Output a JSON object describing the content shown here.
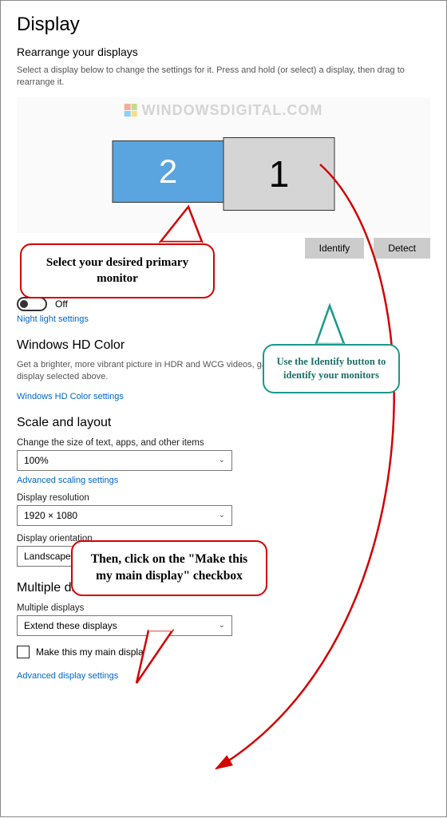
{
  "header": {
    "title": "Display"
  },
  "rearrange": {
    "title": "Rearrange your displays",
    "help": "Select a display below to change the settings for it. Press and hold (or select) a display, then drag to rearrange it.",
    "watermark": "WINDOWSDIGITAL.COM",
    "monitor1_label": "1",
    "monitor2_label": "2",
    "identify_btn": "Identify",
    "detect_btn": "Detect"
  },
  "night_light": {
    "state": "Off",
    "settings_link": "Night light settings"
  },
  "hd_color": {
    "title": "Windows HD Color",
    "help": "Get a brighter, more vibrant picture in HDR and WCG videos, games, and apps on the display selected above.",
    "link": "Windows HD Color settings"
  },
  "scale_layout": {
    "title": "Scale and layout",
    "scale_label": "Change the size of text, apps, and other items",
    "scale_value": "100%",
    "advanced_scaling_link": "Advanced scaling settings",
    "resolution_label": "Display resolution",
    "resolution_value": "1920 × 1080",
    "orientation_label": "Display orientation",
    "orientation_value": "Landscape"
  },
  "multiple": {
    "title": "Multiple displays",
    "label": "Multiple displays",
    "value": "Extend these displays",
    "checkbox_label": "Make this my main display"
  },
  "footer_link": "Advanced display settings",
  "annotations": {
    "callout1": "Select your desired primary monitor",
    "callout2": "Use the Identify button to identify your monitors",
    "callout3": "Then, click on the \"Make this my main display\" checkbox"
  }
}
